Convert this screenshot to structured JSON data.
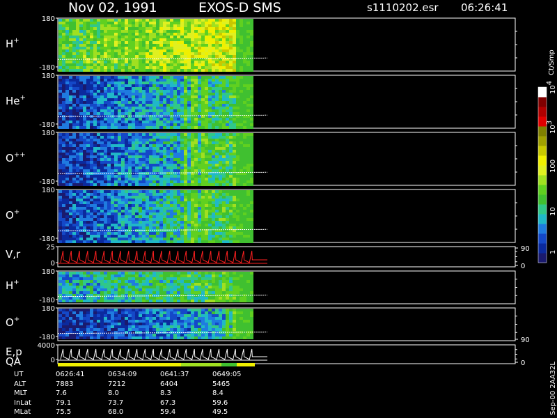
{
  "header": {
    "date": "Nov 02, 1991",
    "instrument": "EXOS-D SMS",
    "file": "s1110202.esr",
    "time": "06:26:41"
  },
  "colorbar": {
    "unit": "Ct/Smp",
    "ticks": [
      "1",
      "10",
      "100",
      "10",
      "10"
    ],
    "tick_exponents": [
      "",
      "",
      "",
      "3",
      "4"
    ],
    "colors": [
      "#1a1a6e",
      "#0b2a9e",
      "#1448c8",
      "#1f7be0",
      "#20b8c8",
      "#30c888",
      "#40c030",
      "#60d020",
      "#a0e020",
      "#e0f020",
      "#f0f000",
      "#c8c800",
      "#a0a000",
      "#808000",
      "#e00000",
      "#b00000",
      "#800000",
      "#ffffff"
    ]
  },
  "footer": {
    "rows": [
      "UT",
      "ALT",
      "MLT",
      "InLat",
      "MLat"
    ],
    "columns": [
      [
        "0626:41",
        "7883",
        "7.6",
        "79.1",
        "75.5"
      ],
      [
        "0634:09",
        "7212",
        "8.0",
        "73.7",
        "68.0"
      ],
      [
        "0641:37",
        "6404",
        "8.3",
        "67.3",
        "59.4"
      ],
      [
        "0649:05",
        "5465",
        "8.4",
        "59.6",
        "49.5"
      ]
    ],
    "side_label": "Sep-00  2AA32L"
  },
  "chart_data": {
    "type": "heatmap",
    "title": "",
    "xlabel": "UT",
    "x_ticks": [
      "0626:41",
      "0634:09",
      "0641:37",
      "0649:05"
    ],
    "panels": [
      {
        "species": "H",
        "charge": "+",
        "ylabel_ticks": [
          "180",
          "-180"
        ],
        "right_ticks": [],
        "style": "spectrogram",
        "level": [
          0.55,
          0.85
        ],
        "yellow_band": [
          0.2,
          0.45
        ]
      },
      {
        "species": "He",
        "charge": "+",
        "ylabel_ticks": [
          "180",
          "-180"
        ],
        "right_ticks": [],
        "style": "spectrogram",
        "level": [
          0.15,
          0.55
        ],
        "yellow_band": [
          0.63,
          0.78
        ]
      },
      {
        "species": "O",
        "charge": "++",
        "ylabel_ticks": [
          "180",
          "-180"
        ],
        "right_ticks": [],
        "style": "spectrogram",
        "level": [
          0.12,
          0.6
        ],
        "yellow_band": [
          0.63,
          0.78
        ]
      },
      {
        "species": "O",
        "charge": "+",
        "ylabel_ticks": [
          "180",
          "-180"
        ],
        "right_ticks": [],
        "style": "spectrogram",
        "level": [
          0.15,
          0.62
        ],
        "yellow_band": [
          0.63,
          0.78
        ]
      },
      {
        "species": "V,r",
        "charge": "",
        "ylabel_ticks": [
          "25",
          "0"
        ],
        "right_ticks": [
          "90",
          "0"
        ],
        "style": "trace",
        "trace_color": "#ff2020"
      },
      {
        "species": "H",
        "charge": "+",
        "ylabel_ticks": [
          "180",
          "-180"
        ],
        "right_ticks": [],
        "style": "spectrogram",
        "level": [
          0.35,
          0.6
        ],
        "yellow_band": [
          0.8,
          0.98
        ]
      },
      {
        "species": "O",
        "charge": "+",
        "ylabel_ticks": [
          "180",
          "-180"
        ],
        "right_ticks": [
          "90"
        ],
        "style": "spectrogram",
        "level": [
          0.1,
          0.45
        ],
        "yellow_band": [
          0.85,
          0.98
        ]
      },
      {
        "species": "E,p",
        "species2": "QA",
        "charge": "",
        "ylabel_ticks": [
          "4000",
          "0"
        ],
        "right_ticks": [
          "0"
        ],
        "style": "trace",
        "trace_color": "#ffffff"
      }
    ]
  }
}
